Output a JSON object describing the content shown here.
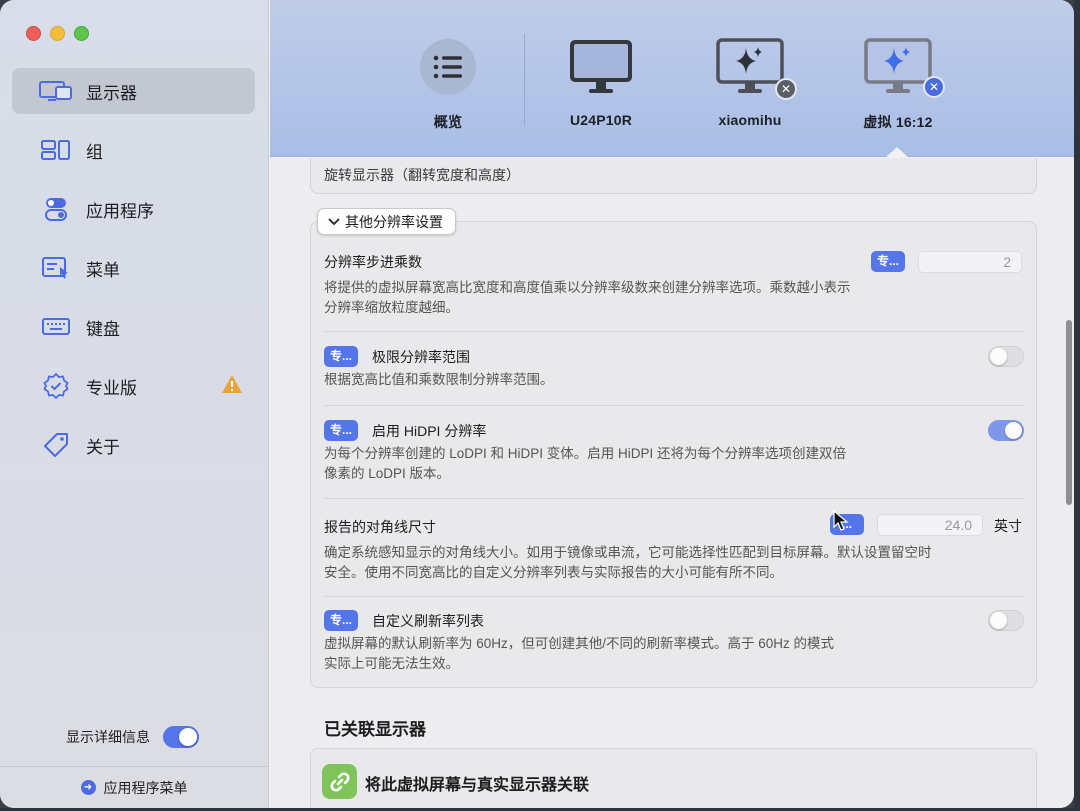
{
  "sidebar": {
    "items": [
      {
        "label": "显示器",
        "icon": "displays-icon",
        "active": true
      },
      {
        "label": "组",
        "icon": "groups-icon"
      },
      {
        "label": "应用程序",
        "icon": "apps-toggle-icon"
      },
      {
        "label": "菜单",
        "icon": "menu-icon"
      },
      {
        "label": "键盘",
        "icon": "keyboard-icon"
      },
      {
        "label": "专业版",
        "icon": "pro-badge-icon",
        "warning": true
      },
      {
        "label": "关于",
        "icon": "tag-icon"
      }
    ],
    "show_details_label": "显示详细信息",
    "show_details_on": true,
    "app_menu_label": "应用程序菜单"
  },
  "topbar": {
    "items": [
      {
        "label": "概览",
        "icon": "list-icon"
      },
      {
        "label": "U24P10R",
        "icon": "monitor-icon"
      },
      {
        "label": "xiaomihu",
        "icon": "virtual-monitor-icon",
        "badge_color": "#5b5f66"
      },
      {
        "label": "虚拟 16:12",
        "icon": "virtual-monitor-icon",
        "badge_color": "#4a6ce0",
        "selected": true
      }
    ]
  },
  "main": {
    "rotate_text": "旋转显示器（翻转宽度和高度）",
    "section_label": "其他分辨率设置",
    "rows": {
      "step": {
        "title": "分辨率步进乘数",
        "pro": "专...",
        "value": "2",
        "desc_1": "将提供的虚拟屏幕宽高比宽度和高度值乘以分辨率级数来创建分辨率选项。乘数越小表示",
        "desc_2": "分辨率缩放粒度越细。"
      },
      "limit": {
        "title": "极限分辨率范围",
        "pro": "专...",
        "on": false,
        "desc_1": "根据宽高比值和乘数限制分辨率范围。"
      },
      "hidpi": {
        "title": "启用 HiDPI 分辨率",
        "pro": "专...",
        "on": true,
        "desc_1": "为每个分辨率创建的 LoDPI 和 HiDPI 变体。启用 HiDPI 还将为每个分辨率选项创建双倍",
        "desc_2": "像素的 LoDPI 版本。"
      },
      "diag": {
        "title": "报告的对角线尺寸",
        "pro": "...",
        "value": "24.0",
        "unit": "英寸",
        "desc_1": "确定系统感知显示的对角线大小。如用于镜像或串流，它可能选择性匹配到目标屏幕。默认设置留空时",
        "desc_2": "安全。使用不同宽高比的自定义分辨率列表与实际报告的大小可能有所不同。"
      },
      "refresh": {
        "title": "自定义刷新率列表",
        "pro": "专...",
        "on": false,
        "desc_1": "虚拟屏幕的默认刷新率为 60Hz，但可创建其他/不同的刷新率模式。高于 60Hz 的模式",
        "desc_2": "实际上可能无法生效。"
      }
    },
    "linked_title": "已关联显示器",
    "link_action": "将此虚拟屏幕与真实显示器关联"
  },
  "colors": {
    "accent": "#5576e8",
    "warning": "#e8a33a",
    "link_green": "#7fc45a"
  }
}
